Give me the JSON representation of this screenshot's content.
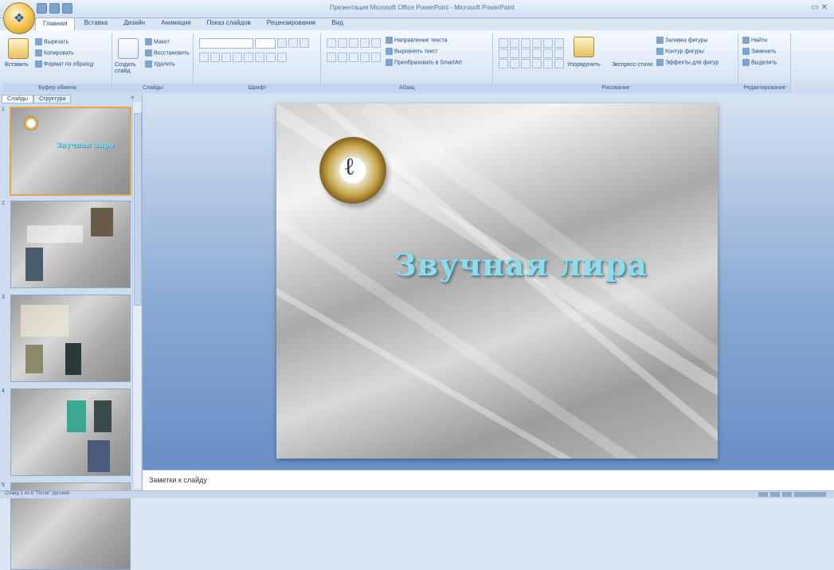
{
  "window": {
    "title": "Презентация Microsoft Office PowerPoint - Microsoft PowerPoint",
    "qat_icons": [
      "save-icon",
      "undo-icon",
      "redo-icon"
    ]
  },
  "ribbon": {
    "tabs": [
      {
        "label": "Главная",
        "active": true
      },
      {
        "label": "Вставка"
      },
      {
        "label": "Дизайн"
      },
      {
        "label": "Анимация"
      },
      {
        "label": "Показ слайдов"
      },
      {
        "label": "Рецензирование"
      },
      {
        "label": "Вид"
      }
    ],
    "clipboard": {
      "paste": "Вставить",
      "cut": "Вырезать",
      "copy": "Копировать",
      "format_painter": "Формат по образцу",
      "label": "Буфер обмена"
    },
    "slides": {
      "new_slide": "Создать слайд",
      "layout": "Макет",
      "reset": "Восстановить",
      "delete": "Удалить",
      "label": "Слайды"
    },
    "font": {
      "label": "Шрифт"
    },
    "paragraph": {
      "text_direction": "Направление текста",
      "align_text": "Выровнять текст",
      "convert_smartart": "Преобразовать в SmartArt",
      "label": "Абзац"
    },
    "drawing": {
      "arrange": "Упорядочить",
      "quick_styles": "Экспресс-стили",
      "shape_fill": "Заливка фигуры",
      "shape_outline": "Контур фигуры",
      "shape_effects": "Эффекты для фигур",
      "label": "Рисование"
    },
    "editing": {
      "find": "Найти",
      "replace": "Заменить",
      "select": "Выделить",
      "label": "Редактирование"
    }
  },
  "panel": {
    "tabs": [
      {
        "label": "Слайды",
        "active": true
      },
      {
        "label": "Структура"
      }
    ],
    "close": "×",
    "thumbnails": [
      {
        "num": "1",
        "caption": "Звучная лира",
        "selected": true
      },
      {
        "num": "2"
      },
      {
        "num": "3"
      },
      {
        "num": "4"
      },
      {
        "num": "5"
      }
    ]
  },
  "slide": {
    "title": "Звучная лира",
    "emblem_icon": "lyre-emblem-icon"
  },
  "notes": {
    "placeholder": "Заметки к слайду"
  },
  "status": {
    "text": "Слайд 1 из 6   \"Поток\"   русский"
  }
}
